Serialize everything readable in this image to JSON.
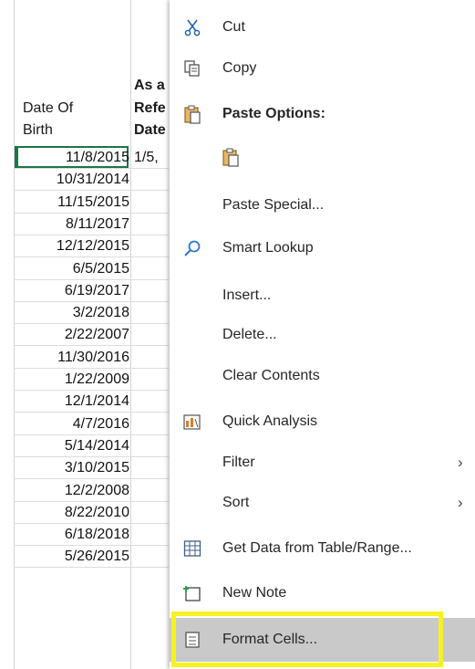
{
  "sheet": {
    "header_col1": [
      "Date Of",
      "Birth"
    ],
    "header_col2": [
      "As a",
      "Refe",
      "Date"
    ],
    "selected_partial": "1/5,",
    "dates": [
      "11/8/2015",
      "10/31/2014",
      "11/15/2015",
      "8/11/2017",
      "12/12/2015",
      "6/5/2015",
      "6/19/2017",
      "3/2/2018",
      "2/22/2007",
      "11/30/2016",
      "1/22/2009",
      "12/1/2014",
      "4/7/2016",
      "5/14/2014",
      "3/10/2015",
      "12/2/2008",
      "8/22/2010",
      "6/18/2018",
      "5/26/2015"
    ]
  },
  "menu": {
    "cut": "Cut",
    "copy": "Copy",
    "paste_options": "Paste Options:",
    "paste_special": "Paste Special...",
    "smart_lookup": "Smart Lookup",
    "insert": "Insert...",
    "delete": "Delete...",
    "clear_contents": "Clear Contents",
    "quick_analysis": "Quick Analysis",
    "filter": "Filter",
    "sort": "Sort",
    "get_data": "Get Data from Table/Range...",
    "new_note": "New Note",
    "format_cells": "Format Cells..."
  },
  "colors": {
    "highlight_border": "#f6f222",
    "selection": "#217346",
    "hover": "#c9c9c9"
  }
}
